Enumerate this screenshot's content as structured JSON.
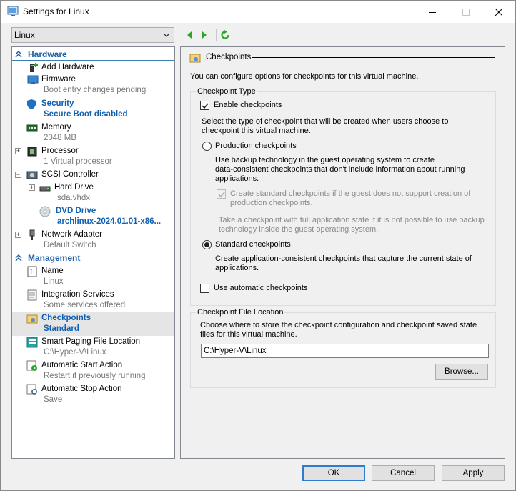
{
  "window": {
    "title": "Settings for Linux"
  },
  "vm_selector": {
    "value": "Linux"
  },
  "hardware_header": "Hardware",
  "management_header": "Management",
  "hardware_items": [
    {
      "name": "Add Hardware",
      "sub": ""
    },
    {
      "name": "Firmware",
      "sub": "Boot entry changes pending"
    },
    {
      "name": "Security",
      "sub": "Secure Boot disabled"
    },
    {
      "name": "Memory",
      "sub": "2048 MB"
    },
    {
      "name": "Processor",
      "sub": "1 Virtual processor"
    },
    {
      "name": "SCSI Controller",
      "sub": ""
    },
    {
      "name": "Hard Drive",
      "sub": "sda.vhdx"
    },
    {
      "name": "DVD Drive",
      "sub": "archlinux-2024.01.01-x86..."
    },
    {
      "name": "Network Adapter",
      "sub": "Default Switch"
    }
  ],
  "management_items": [
    {
      "name": "Name",
      "sub": "Linux"
    },
    {
      "name": "Integration Services",
      "sub": "Some services offered"
    },
    {
      "name": "Checkpoints",
      "sub": "Standard"
    },
    {
      "name": "Smart Paging File Location",
      "sub": "C:\\Hyper-V\\Linux"
    },
    {
      "name": "Automatic Start Action",
      "sub": "Restart if previously running"
    },
    {
      "name": "Automatic Stop Action",
      "sub": "Save"
    }
  ],
  "checkpoints": {
    "title": "Checkpoints",
    "intro": "You can configure options for checkpoints for this virtual machine.",
    "type_group_label": "Checkpoint Type",
    "enable_label": "Enable checkpoints",
    "enable_checked": true,
    "select_desc_1": "Select the type of checkpoint that will be created when users choose to",
    "select_desc_2": "checkpoint this virtual machine.",
    "production_label": "Production checkpoints",
    "production_desc_1": "Use backup technology in the guest operating system to create",
    "production_desc_2": "data-consistent checkpoints that don't include information about running",
    "production_desc_3": "applications.",
    "fallback_label_1": "Create standard checkpoints if the guest does not support creation of",
    "fallback_label_2": "production checkpoints.",
    "fallback_desc_1": "Take a checkpoint with full application state if it is not possible to use backup",
    "fallback_desc_2": "technology inside the guest operating system.",
    "standard_label": "Standard checkpoints",
    "standard_selected": true,
    "standard_desc_1": "Create application-consistent checkpoints that capture the current state of",
    "standard_desc_2": "applications.",
    "auto_label": "Use automatic checkpoints",
    "auto_checked": false,
    "location_group_label": "Checkpoint File Location",
    "location_desc_1": "Choose where to store the checkpoint configuration and checkpoint saved state",
    "location_desc_2": "files for this virtual machine.",
    "location_value": "C:\\Hyper-V\\Linux",
    "browse_label": "Browse..."
  },
  "footer": {
    "ok": "OK",
    "cancel": "Cancel",
    "apply": "Apply"
  }
}
